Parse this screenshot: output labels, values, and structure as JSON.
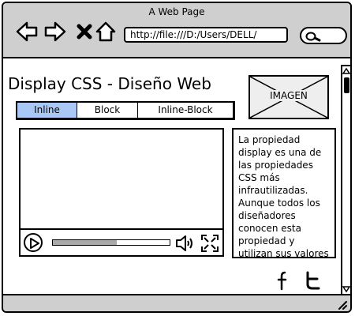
{
  "window": {
    "title": "A Web Page"
  },
  "browser": {
    "url": "http://file:///D:/Users/DELL/",
    "nav_icons": [
      "back-arrow-icon",
      "forward-arrow-icon",
      "close-icon",
      "home-icon"
    ],
    "search_icon": "search-icon"
  },
  "page": {
    "title": "Display CSS - Diseño Web",
    "image_label": "IMAGEN",
    "tabs": [
      {
        "label": "Inline",
        "active": true
      },
      {
        "label": "Block",
        "active": false
      },
      {
        "label": "Inline-Block",
        "active": false
      }
    ],
    "body_text": "La propiedad display es una de las propiedades CSS más infrautilizadas. Aunque todos los diseñadores conocen esta propiedad y utilizan sus valores inline,",
    "video": {
      "progress": 0.55,
      "icons": [
        "play-icon",
        "volume-icon",
        "fullscreen-icon"
      ]
    },
    "social_icons": [
      "facebook-icon",
      "twitter-icon"
    ]
  },
  "colors": {
    "chrome": "#cfcfcf",
    "active_tab": "#a9c8f5",
    "progress_fill": "#aaaaaa"
  }
}
